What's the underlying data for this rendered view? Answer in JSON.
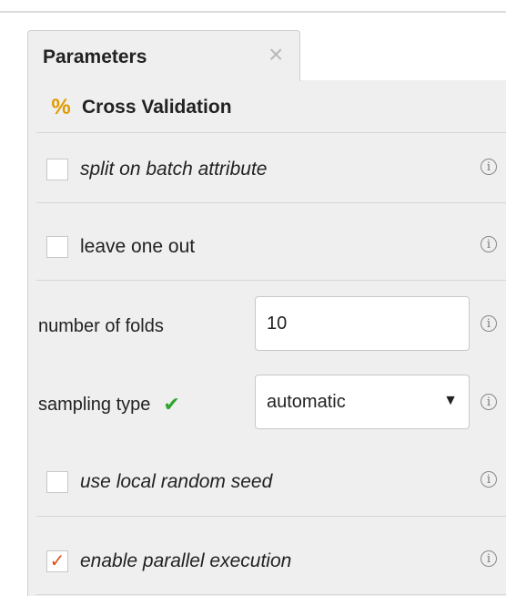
{
  "tab": {
    "title": "Parameters",
    "close_glyph": "×"
  },
  "operator": {
    "icon": "percent-icon",
    "icon_glyph": "%",
    "name": "Cross Validation"
  },
  "params": {
    "split_on_batch": {
      "label": "split on batch attribute",
      "checked": false
    },
    "leave_one_out": {
      "label": "leave one out",
      "checked": false
    },
    "number_of_folds": {
      "label": "number of folds",
      "value": "10"
    },
    "sampling_type": {
      "label": "sampling type",
      "value": "automatic",
      "status_icon": "green-check-icon"
    },
    "use_local_random_seed": {
      "label": "use local random seed",
      "checked": false
    },
    "enable_parallel_execution": {
      "label": "enable parallel execution",
      "checked": true
    }
  },
  "info_glyph": "i",
  "colors": {
    "accent_check": "#e0501b",
    "valid_green": "#2ea62e",
    "operator_icon": "#e09a00"
  }
}
